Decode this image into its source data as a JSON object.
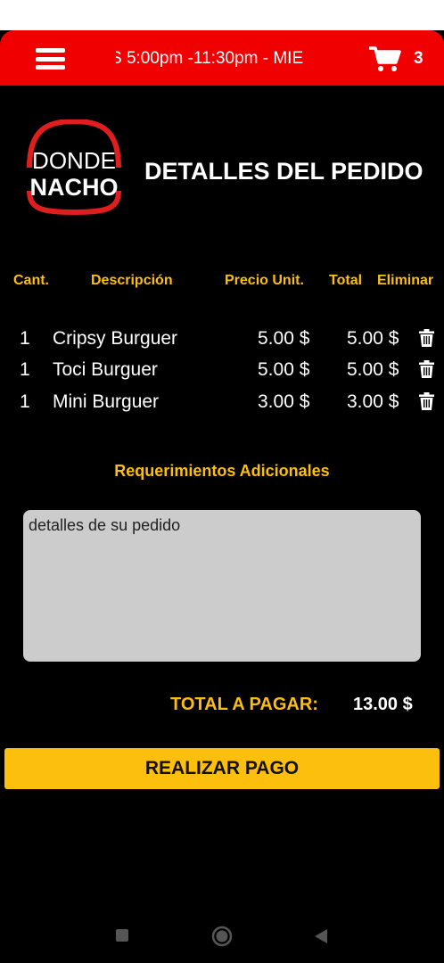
{
  "header": {
    "marquee_text": "S 5:00pm -11:30pm - MIE",
    "cart_count": "3"
  },
  "logo": {
    "line1": "DONDE",
    "line2": "NACHO"
  },
  "page": {
    "title": "DETALLES DEL PEDIDO"
  },
  "table": {
    "headers": {
      "qty": "Cant.",
      "desc": "Descripción",
      "unit": "Precio Unit.",
      "total": "Total",
      "delete": "Eliminar"
    },
    "rows": [
      {
        "qty": "1",
        "desc": "Cripsy Burguer",
        "unit": "5.00 $",
        "total": "5.00 $"
      },
      {
        "qty": "1",
        "desc": "Toci Burguer",
        "unit": "5.00 $",
        "total": "5.00 $"
      },
      {
        "qty": "1",
        "desc": "Mini Burguer",
        "unit": "3.00 $",
        "total": "3.00 $"
      }
    ]
  },
  "requirements": {
    "label": "Requerimientos Adicionales",
    "placeholder": "detalles de su pedido"
  },
  "summary": {
    "label": "TOTAL A PAGAR:",
    "value": "13.00 $"
  },
  "actions": {
    "pay_label": "REALIZAR PAGO"
  },
  "icons": {
    "menu": "hamburger-menu-icon",
    "cart": "shopping-cart-icon",
    "delete": "trash-icon",
    "nav_recents": "square-icon",
    "nav_home": "circle-icon",
    "nav_back": "triangle-back-icon"
  },
  "colors": {
    "header_bg": "#f00000",
    "accent": "#fdbf0e",
    "background": "#000000",
    "textarea_bg": "#cccccc"
  }
}
